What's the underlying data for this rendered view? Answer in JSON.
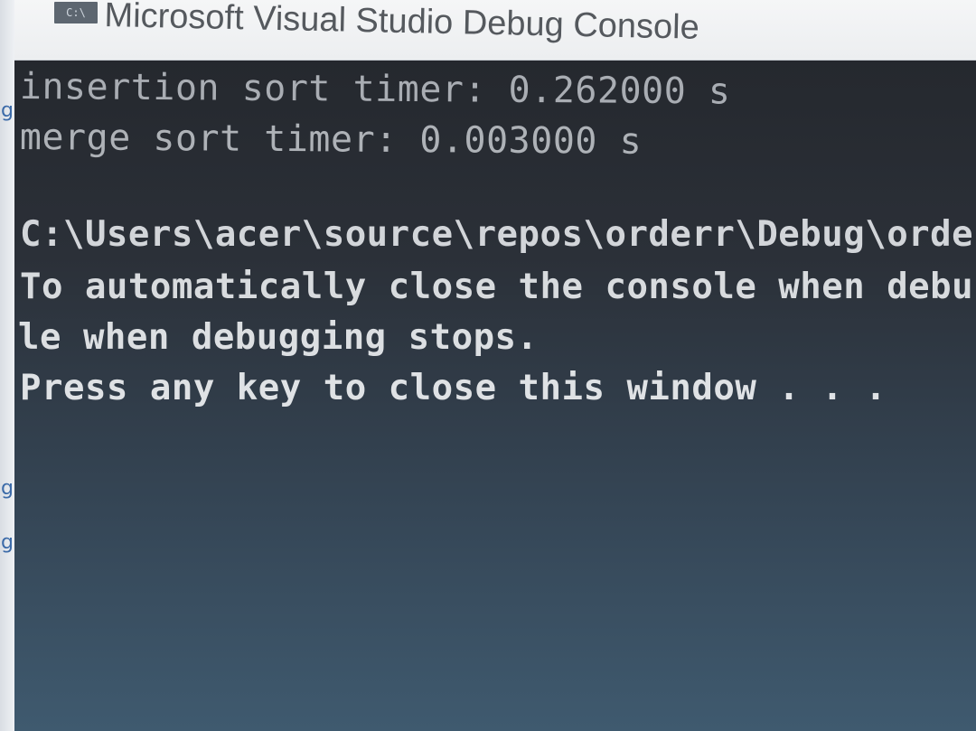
{
  "window": {
    "title": "Microsoft Visual Studio Debug Console",
    "icon": "console-app-icon",
    "icon_glyph": "C:\\"
  },
  "background_window": {
    "glyphs": [
      "g",
      "g",
      "g"
    ]
  },
  "console": {
    "lines": [
      "insertion sort timer: 0.262000 s",
      "merge sort timer: 0.003000 s",
      "",
      "C:\\Users\\acer\\source\\repos\\orderr\\Debug\\orde",
      "To automatically close the console when debu",
      "le when debugging stops.",
      "Press any key to close this window . . ."
    ]
  },
  "colors": {
    "title_bar_bg": "#eceef0",
    "title_text": "#55595e",
    "console_bg": "#2b3038",
    "console_text": "#cccccc"
  }
}
